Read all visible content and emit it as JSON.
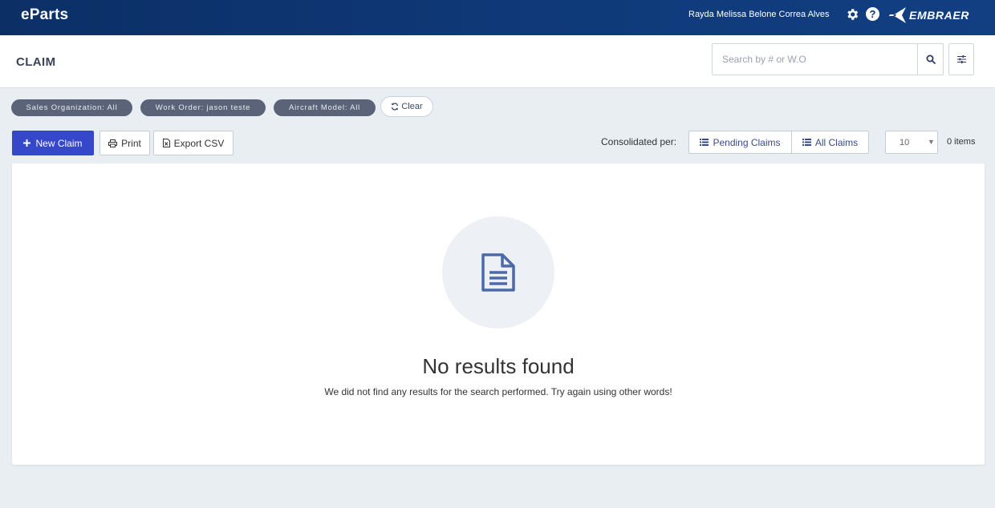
{
  "app": {
    "logo": "eParts",
    "user_name": "Rayda Melissa Belone Correa Alves",
    "brand": "EMBRAER"
  },
  "header": {
    "title": "CLAIM",
    "search_placeholder": "Search by # or W.O"
  },
  "filters": {
    "chips": [
      {
        "label": "Sales Organization: All"
      },
      {
        "label": "Work Order: jason teste"
      },
      {
        "label": "Aircraft Model: All"
      }
    ],
    "clear_label": "Clear"
  },
  "toolbar": {
    "new_label": "New Claim",
    "print_label": "Print",
    "export_label": "Export CSV",
    "consolidated_label": "Consolidated per:",
    "pending_label": "Pending Claims",
    "all_label": "All Claims",
    "per_page": "10",
    "items_count": "0 items"
  },
  "results": {
    "empty_title": "No results found",
    "empty_message": "We did not find any results for the search performed. Try again using other words!"
  },
  "colors": {
    "topbar": "#0f3a7a",
    "primary": "#3448c9",
    "chip": "#5a6378"
  },
  "icons": [
    "gear-icon",
    "help-icon",
    "search-icon",
    "sliders-icon",
    "refresh-icon",
    "plus-icon",
    "print-icon",
    "file-excel-icon",
    "list-icon",
    "document-icon"
  ]
}
